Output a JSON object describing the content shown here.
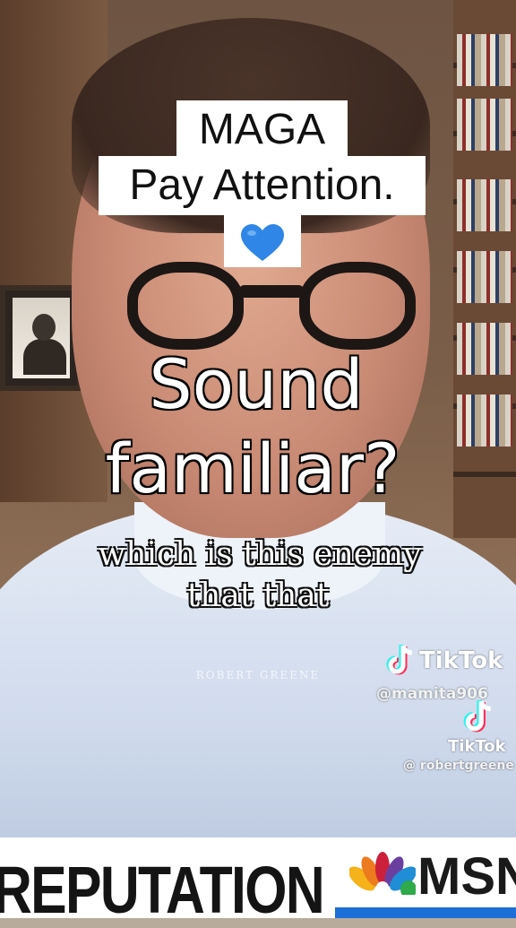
{
  "overlay_labels": {
    "line1": "MAGA",
    "line2": "Pay Attention.",
    "heart_emoji": "💙"
  },
  "caption": {
    "line1": "Sound",
    "line2": "familiar?"
  },
  "subtitle": {
    "line1": "which is this enemy",
    "line2": "that that"
  },
  "brand_mark": "ROBERT GREENE",
  "tiktok_watermark_1": {
    "icon": "tiktok-logo-icon",
    "label": "TikTok",
    "handle": "@mamita906"
  },
  "tiktok_watermark_2": {
    "icon": "tiktok-logo-icon",
    "label": "TikTok",
    "handle": "@ robertgreene"
  },
  "news_ticker": {
    "text": "REPUTATION",
    "network": "MSN",
    "network_icon": "peacock-logo-icon"
  },
  "colors": {
    "heart": "#2f86e6",
    "ticker_strip": "#1d6fd8"
  }
}
